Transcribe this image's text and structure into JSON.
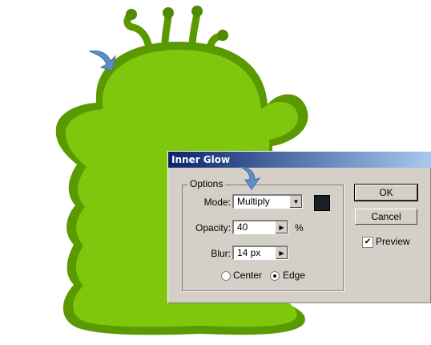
{
  "dialog": {
    "title": "Inner Glow",
    "options_legend": "Options",
    "mode_label": "Mode:",
    "mode_value": "Multiply",
    "glow_color": "#18212a",
    "opacity_label": "Opacity:",
    "opacity_value": "40",
    "opacity_unit": "%",
    "blur_label": "Blur:",
    "blur_value": "14 px",
    "center_label": "Center",
    "edge_label": "Edge",
    "selected_source": "Edge",
    "ok_label": "OK",
    "cancel_label": "Cancel",
    "preview_label": "Preview",
    "preview_checked": true
  },
  "artwork": {
    "body_color": "#7ec70c",
    "glow_color": "#5a9a00",
    "arrow_color": "#5b8fc6"
  }
}
